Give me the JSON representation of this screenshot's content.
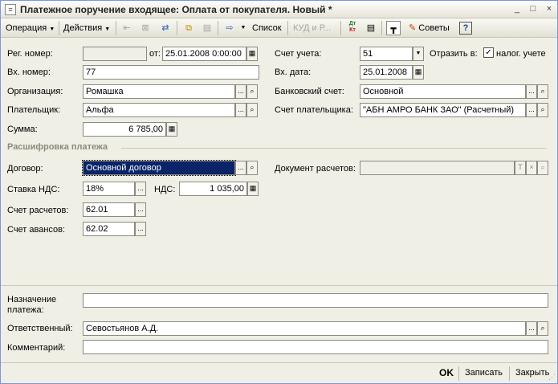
{
  "window": {
    "title": "Платежное поручение входящее: Оплата от покупателя. Новый *",
    "app_icon": "doc-icon",
    "minimize": "_",
    "maximize": "□",
    "close": "×"
  },
  "toolbar": {
    "operation": "Операция",
    "actions": "Действия",
    "list": "Список",
    "kud": "КУД и Р...",
    "tips": "Советы",
    "help": "?",
    "dt": "Дт",
    "kt": "Кт"
  },
  "form": {
    "reg_number_label": "Рег. номер:",
    "reg_number_value": "",
    "from_label": "от:",
    "from_value": "25.01.2008  0:00:00",
    "account_label": "Счет учета:",
    "account_value": "51",
    "reflect_label": "Отразить в:",
    "tax_accounting_label": "налог. учете",
    "tax_accounting_checked": "✓",
    "in_number_label": "Вх. номер:",
    "in_number_value": "77",
    "in_date_label": "Вх. дата:",
    "in_date_value": "25.01.2008",
    "org_label": "Организация:",
    "org_value": "Ромашка",
    "bank_account_label": "Банковский счет:",
    "bank_account_value": "Основной",
    "payer_label": "Плательщик:",
    "payer_value": "Альфа",
    "payer_account_label": "Счет плательщика:",
    "payer_account_value": "\"АБН АМРО БАНК ЗАО\" (Расчетный)",
    "sum_label": "Сумма:",
    "sum_value": "6 785,00"
  },
  "decode": {
    "title": "Расшифровка платежа",
    "contract_label": "Договор:",
    "contract_value": "Основной договор",
    "settlement_doc_label": "Документ расчетов:",
    "settlement_doc_value": "",
    "vat_rate_label": "Ставка НДС:",
    "vat_rate_value": "18%",
    "vat_label": "НДС:",
    "vat_value": "1 035,00",
    "settle_account_label": "Счет расчетов:",
    "settle_account_value": "62.01",
    "advance_account_label": "Счет авансов:",
    "advance_account_value": "62.02"
  },
  "bottom": {
    "purpose_label_1": "Назначение",
    "purpose_label_2": "платежа:",
    "purpose_value": "",
    "responsible_label": "Ответственный:",
    "responsible_value": "Севостьянов А.Д.",
    "comment_label": "Комментарий:",
    "comment_value": ""
  },
  "footer": {
    "ok": "OK",
    "save": "Записать",
    "close": "Закрыть"
  },
  "glyphs": {
    "ellipsis": "...",
    "search": "⌕",
    "calendar": "▦",
    "dropdown": "▼",
    "clear": "×",
    "t_icon": "T"
  }
}
